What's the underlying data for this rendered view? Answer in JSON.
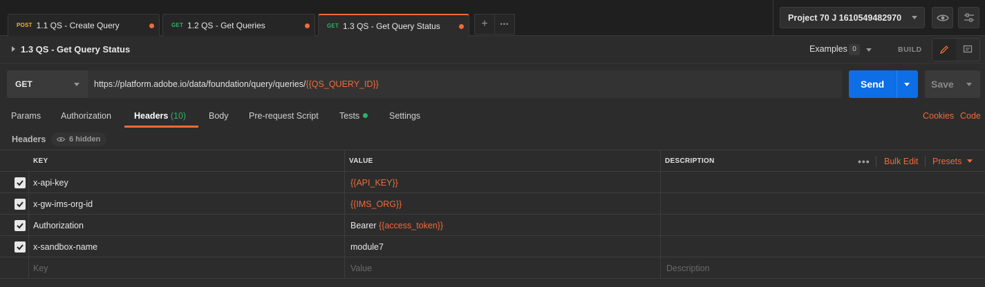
{
  "tabs": [
    {
      "method": "POST",
      "method_color": "#f5b82e",
      "name": "1.1 QS - Create Query"
    },
    {
      "method": "GET",
      "method_color": "#2cb46a",
      "name": "1.2 QS - Get Queries"
    },
    {
      "method": "GET",
      "method_color": "#2cb46a",
      "name": "1.3 QS - Get Query Status"
    }
  ],
  "tab_controls": {
    "add_icon": "plus-icon",
    "more_icon": "ellipsis-icon",
    "add_label": "+",
    "more_label": "•••"
  },
  "workspace": {
    "name": "Project 70 J 1610549482970"
  },
  "request": {
    "title": "1.3 QS - Get Query Status",
    "examples_label": "Examples",
    "examples_count": "0",
    "build_label": "BUILD",
    "method": "GET",
    "url_prefix": "https://platform.adobe.io/data/foundation/query/queries/",
    "url_variable": "{{QS_QUERY_ID}}",
    "send_label": "Send",
    "save_label": "Save"
  },
  "request_tabs": {
    "params": "Params",
    "authorization": "Authorization",
    "headers": "Headers",
    "headers_count": "(10)",
    "body": "Body",
    "prerequest": "Pre-request Script",
    "tests": "Tests",
    "settings": "Settings",
    "cookies": "Cookies",
    "code": "Code"
  },
  "headers_section": {
    "label": "Headers",
    "hidden_count": "6 hidden"
  },
  "table": {
    "columns": {
      "key": "KEY",
      "value": "VALUE",
      "description": "DESCRIPTION"
    },
    "actions": {
      "bulk_edit": "Bulk Edit",
      "presets": "Presets",
      "more": "•••"
    },
    "rows": [
      {
        "checked": true,
        "key": "x-api-key",
        "value_text": "",
        "value_var": "{{API_KEY}}"
      },
      {
        "checked": true,
        "key": "x-gw-ims-org-id",
        "value_text": "",
        "value_var": "{{IMS_ORG}}"
      },
      {
        "checked": true,
        "key": "Authorization",
        "value_text": "Bearer ",
        "value_var": "{{access_token}}"
      },
      {
        "checked": true,
        "key": "x-sandbox-name",
        "value_text": "module7",
        "value_var": ""
      }
    ],
    "placeholders": {
      "key": "Key",
      "value": "Value",
      "description": "Description"
    }
  },
  "colors": {
    "accent": "#f26b3a",
    "send": "#0d6ee5",
    "get": "#2cb46a",
    "post": "#f5b82e"
  }
}
